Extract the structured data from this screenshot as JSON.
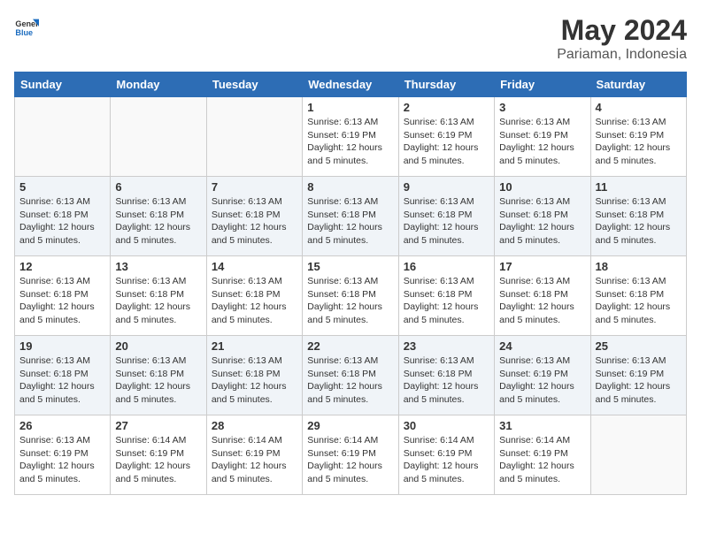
{
  "header": {
    "logo_general": "General",
    "logo_blue": "Blue",
    "month_title": "May 2024",
    "location": "Pariaman, Indonesia"
  },
  "weekdays": [
    "Sunday",
    "Monday",
    "Tuesday",
    "Wednesday",
    "Thursday",
    "Friday",
    "Saturday"
  ],
  "weeks": [
    [
      {
        "day": "",
        "info": ""
      },
      {
        "day": "",
        "info": ""
      },
      {
        "day": "",
        "info": ""
      },
      {
        "day": "1",
        "sunrise": "Sunrise: 6:13 AM",
        "sunset": "Sunset: 6:19 PM",
        "daylight": "Daylight: 12 hours and 5 minutes."
      },
      {
        "day": "2",
        "sunrise": "Sunrise: 6:13 AM",
        "sunset": "Sunset: 6:19 PM",
        "daylight": "Daylight: 12 hours and 5 minutes."
      },
      {
        "day": "3",
        "sunrise": "Sunrise: 6:13 AM",
        "sunset": "Sunset: 6:19 PM",
        "daylight": "Daylight: 12 hours and 5 minutes."
      },
      {
        "day": "4",
        "sunrise": "Sunrise: 6:13 AM",
        "sunset": "Sunset: 6:19 PM",
        "daylight": "Daylight: 12 hours and 5 minutes."
      }
    ],
    [
      {
        "day": "5",
        "sunrise": "Sunrise: 6:13 AM",
        "sunset": "Sunset: 6:18 PM",
        "daylight": "Daylight: 12 hours and 5 minutes."
      },
      {
        "day": "6",
        "sunrise": "Sunrise: 6:13 AM",
        "sunset": "Sunset: 6:18 PM",
        "daylight": "Daylight: 12 hours and 5 minutes."
      },
      {
        "day": "7",
        "sunrise": "Sunrise: 6:13 AM",
        "sunset": "Sunset: 6:18 PM",
        "daylight": "Daylight: 12 hours and 5 minutes."
      },
      {
        "day": "8",
        "sunrise": "Sunrise: 6:13 AM",
        "sunset": "Sunset: 6:18 PM",
        "daylight": "Daylight: 12 hours and 5 minutes."
      },
      {
        "day": "9",
        "sunrise": "Sunrise: 6:13 AM",
        "sunset": "Sunset: 6:18 PM",
        "daylight": "Daylight: 12 hours and 5 minutes."
      },
      {
        "day": "10",
        "sunrise": "Sunrise: 6:13 AM",
        "sunset": "Sunset: 6:18 PM",
        "daylight": "Daylight: 12 hours and 5 minutes."
      },
      {
        "day": "11",
        "sunrise": "Sunrise: 6:13 AM",
        "sunset": "Sunset: 6:18 PM",
        "daylight": "Daylight: 12 hours and 5 minutes."
      }
    ],
    [
      {
        "day": "12",
        "sunrise": "Sunrise: 6:13 AM",
        "sunset": "Sunset: 6:18 PM",
        "daylight": "Daylight: 12 hours and 5 minutes."
      },
      {
        "day": "13",
        "sunrise": "Sunrise: 6:13 AM",
        "sunset": "Sunset: 6:18 PM",
        "daylight": "Daylight: 12 hours and 5 minutes."
      },
      {
        "day": "14",
        "sunrise": "Sunrise: 6:13 AM",
        "sunset": "Sunset: 6:18 PM",
        "daylight": "Daylight: 12 hours and 5 minutes."
      },
      {
        "day": "15",
        "sunrise": "Sunrise: 6:13 AM",
        "sunset": "Sunset: 6:18 PM",
        "daylight": "Daylight: 12 hours and 5 minutes."
      },
      {
        "day": "16",
        "sunrise": "Sunrise: 6:13 AM",
        "sunset": "Sunset: 6:18 PM",
        "daylight": "Daylight: 12 hours and 5 minutes."
      },
      {
        "day": "17",
        "sunrise": "Sunrise: 6:13 AM",
        "sunset": "Sunset: 6:18 PM",
        "daylight": "Daylight: 12 hours and 5 minutes."
      },
      {
        "day": "18",
        "sunrise": "Sunrise: 6:13 AM",
        "sunset": "Sunset: 6:18 PM",
        "daylight": "Daylight: 12 hours and 5 minutes."
      }
    ],
    [
      {
        "day": "19",
        "sunrise": "Sunrise: 6:13 AM",
        "sunset": "Sunset: 6:18 PM",
        "daylight": "Daylight: 12 hours and 5 minutes."
      },
      {
        "day": "20",
        "sunrise": "Sunrise: 6:13 AM",
        "sunset": "Sunset: 6:18 PM",
        "daylight": "Daylight: 12 hours and 5 minutes."
      },
      {
        "day": "21",
        "sunrise": "Sunrise: 6:13 AM",
        "sunset": "Sunset: 6:18 PM",
        "daylight": "Daylight: 12 hours and 5 minutes."
      },
      {
        "day": "22",
        "sunrise": "Sunrise: 6:13 AM",
        "sunset": "Sunset: 6:18 PM",
        "daylight": "Daylight: 12 hours and 5 minutes."
      },
      {
        "day": "23",
        "sunrise": "Sunrise: 6:13 AM",
        "sunset": "Sunset: 6:18 PM",
        "daylight": "Daylight: 12 hours and 5 minutes."
      },
      {
        "day": "24",
        "sunrise": "Sunrise: 6:13 AM",
        "sunset": "Sunset: 6:19 PM",
        "daylight": "Daylight: 12 hours and 5 minutes."
      },
      {
        "day": "25",
        "sunrise": "Sunrise: 6:13 AM",
        "sunset": "Sunset: 6:19 PM",
        "daylight": "Daylight: 12 hours and 5 minutes."
      }
    ],
    [
      {
        "day": "26",
        "sunrise": "Sunrise: 6:13 AM",
        "sunset": "Sunset: 6:19 PM",
        "daylight": "Daylight: 12 hours and 5 minutes."
      },
      {
        "day": "27",
        "sunrise": "Sunrise: 6:14 AM",
        "sunset": "Sunset: 6:19 PM",
        "daylight": "Daylight: 12 hours and 5 minutes."
      },
      {
        "day": "28",
        "sunrise": "Sunrise: 6:14 AM",
        "sunset": "Sunset: 6:19 PM",
        "daylight": "Daylight: 12 hours and 5 minutes."
      },
      {
        "day": "29",
        "sunrise": "Sunrise: 6:14 AM",
        "sunset": "Sunset: 6:19 PM",
        "daylight": "Daylight: 12 hours and 5 minutes."
      },
      {
        "day": "30",
        "sunrise": "Sunrise: 6:14 AM",
        "sunset": "Sunset: 6:19 PM",
        "daylight": "Daylight: 12 hours and 5 minutes."
      },
      {
        "day": "31",
        "sunrise": "Sunrise: 6:14 AM",
        "sunset": "Sunset: 6:19 PM",
        "daylight": "Daylight: 12 hours and 5 minutes."
      },
      {
        "day": "",
        "info": ""
      }
    ]
  ]
}
